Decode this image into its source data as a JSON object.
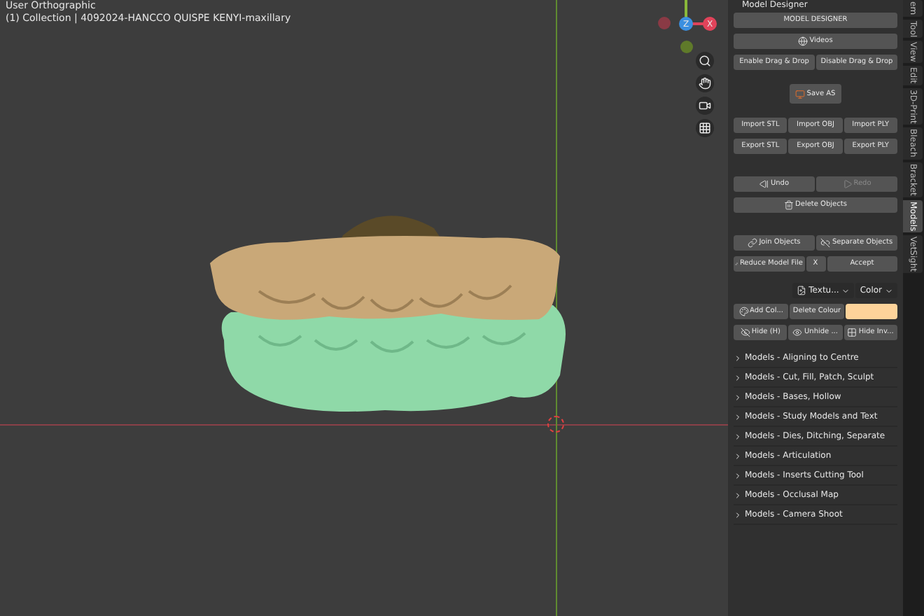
{
  "viewport": {
    "view_name": "User Orthographic",
    "collection": "(1) Collection | 4092024-HANCCO QUISPE KENYI-maxillary",
    "gizmo_labels": [
      "Z",
      "X"
    ]
  },
  "panel": {
    "title": "Model Designer",
    "rows": [
      {
        "kind": "buttons",
        "buttons": [
          {
            "label": "MODEL DESIGNER"
          }
        ]
      },
      {
        "kind": "buttons",
        "buttons": [
          {
            "label": "Videos"
          }
        ]
      },
      {
        "kind": "buttons",
        "buttons": [
          {
            "label": "Enable Drag & Drop"
          },
          {
            "label": "Disable Drag & Drop"
          }
        ]
      },
      {
        "kind": "save",
        "buttons": [
          {
            "label": "Save AS"
          }
        ]
      },
      {
        "kind": "buttons",
        "buttons": [
          {
            "label": "Import STL"
          },
          {
            "label": "Import OBJ"
          },
          {
            "label": "Import PLY"
          }
        ]
      },
      {
        "kind": "buttons",
        "buttons": [
          {
            "label": "Export STL"
          },
          {
            "label": "Export OBJ"
          },
          {
            "label": "Export PLY"
          }
        ]
      },
      {
        "kind": "gap"
      },
      {
        "kind": "buttons",
        "buttons": [
          {
            "label": "Undo",
            "disabled": false
          },
          {
            "label": "Redo",
            "disabled": true
          }
        ]
      },
      {
        "kind": "buttons",
        "buttons": [
          {
            "label": "Delete Objects"
          }
        ]
      },
      {
        "kind": "gap"
      },
      {
        "kind": "buttons",
        "buttons": [
          {
            "label": "Join Objects"
          },
          {
            "label": "Separate Objects"
          }
        ]
      },
      {
        "kind": "buttons",
        "buttons": [
          {
            "label": "Reduce Model File"
          },
          {
            "label": "X"
          },
          {
            "label": "Accept"
          }
        ]
      },
      {
        "kind": "dropdowns",
        "buttons": [
          {
            "label": "Textu..."
          },
          {
            "label": "Color"
          }
        ]
      },
      {
        "kind": "colour",
        "buttons": [
          {
            "label": "Add Col..."
          },
          {
            "label": "Delete Colour"
          }
        ],
        "color": "#fdd39a"
      },
      {
        "kind": "buttons",
        "buttons": [
          {
            "label": "Hide (H)"
          },
          {
            "label": "Unhide ..."
          },
          {
            "label": "Hide Inv..."
          }
        ]
      }
    ],
    "sections": [
      {
        "label": "Models - Aligning to Centre",
        "expanded": false
      },
      {
        "label": "Models - Cut, Fill, Patch, Sculpt",
        "expanded": false
      },
      {
        "label": "Models - Bases, Hollow",
        "expanded": false
      },
      {
        "label": "Models - Study Models and Text",
        "expanded": false
      },
      {
        "label": "Models - Dies, Ditching, Separate",
        "expanded": false
      },
      {
        "label": "Models - Articulation",
        "expanded": false
      },
      {
        "label": "Models - Inserts Cutting Tool",
        "expanded": false
      },
      {
        "label": "Models - Occlusal Map",
        "expanded": false
      },
      {
        "label": "Models - Camera Shoot",
        "expanded": false
      }
    ]
  },
  "tabs": [
    {
      "label": "em",
      "selected": false
    },
    {
      "label": "Tool",
      "selected": false
    },
    {
      "label": "View",
      "selected": false
    },
    {
      "label": "Edit",
      "selected": false
    },
    {
      "label": "3D-Print",
      "selected": false
    },
    {
      "label": "Bleach",
      "selected": false
    },
    {
      "label": "Bracket",
      "selected": false
    },
    {
      "label": "Models",
      "selected": true
    },
    {
      "label": "VetSight",
      "selected": false
    }
  ]
}
